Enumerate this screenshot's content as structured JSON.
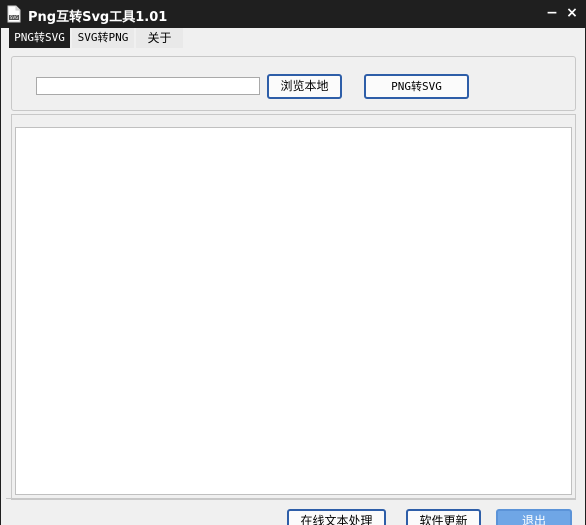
{
  "window": {
    "title": "Png互转Svg工具1.01",
    "minimize_glyph": "−",
    "close_glyph": "×",
    "icon": "svg-file-icon"
  },
  "tabs": [
    {
      "label": "PNG转SVG",
      "active": true
    },
    {
      "label": "SVG转PNG",
      "active": false
    },
    {
      "label": "关于",
      "active": false
    }
  ],
  "top_panel": {
    "path_value": "",
    "browse_label": "浏览本地",
    "convert_label": "PNG转SVG"
  },
  "output": {
    "text": ""
  },
  "footer": {
    "text_processing_label": "在线文本处理",
    "update_label": "软件更新",
    "exit_label": "退出"
  },
  "colors": {
    "titlebar": "#1f1f1f",
    "client_bg": "#f0f0f0",
    "button_border": "#2e5ea8",
    "exit_button_bg": "#6fa6e6"
  }
}
